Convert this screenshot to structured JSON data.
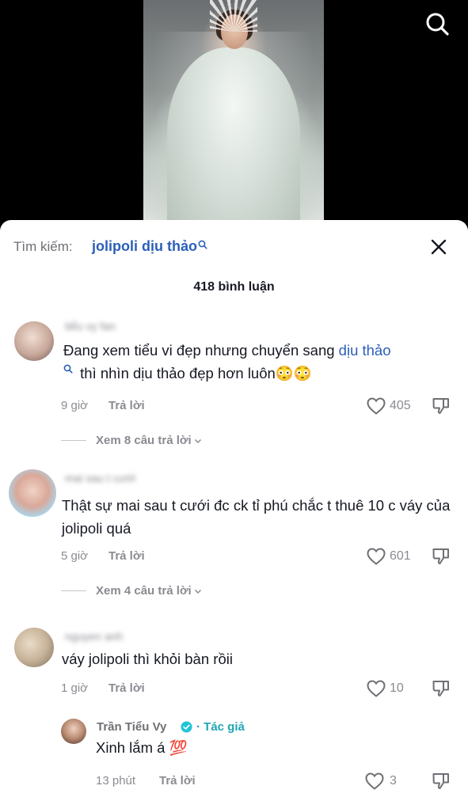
{
  "header": {
    "search_prefix": "Tìm kiếm:",
    "search_term": "jolipoli dịu thảo",
    "comment_count": "418 bình luận"
  },
  "icons": {
    "top_search": "search-icon",
    "close": "close-icon",
    "like": "heart-icon",
    "dislike": "thumbs-down-icon",
    "verified": "verified-badge-icon"
  },
  "colors": {
    "accent_blue": "#2a5fb8",
    "author_tag": "#1fa5b4",
    "verified": "#20c4d6"
  },
  "comments": [
    {
      "username": "tiểu vy fan",
      "text_before": "Đang xem tiểu vi đẹp nhưng chuyển sang ",
      "mention": "dịu thảo",
      "text_after": " thì nhìn dịu thảo đẹp hơn luôn😳😳",
      "time": "9 giờ",
      "reply": "Trả lời",
      "likes": "405",
      "view_replies": "Xem 8 câu trả lời"
    },
    {
      "username": "mai sau t cưới",
      "text": "Thật sự mai sau t cưới đc ck tỉ phú chắc t thuê 10 c váy của jolipoli quá",
      "time": "5 giờ",
      "reply": "Trả lời",
      "likes": "601",
      "view_replies": "Xem 4 câu trả lời"
    },
    {
      "username": "nguyen anh",
      "text": "váy jolipoli thì khỏi bàn rồii",
      "time": "1 giờ",
      "reply": "Trả lời",
      "likes": "10",
      "author_reply": {
        "name": "Trần Tiểu Vy",
        "tag": "· Tác giả",
        "text": "Xinh lắm á 💯",
        "time": "13 phút",
        "reply": "Trả lời",
        "likes": "3"
      }
    }
  ]
}
